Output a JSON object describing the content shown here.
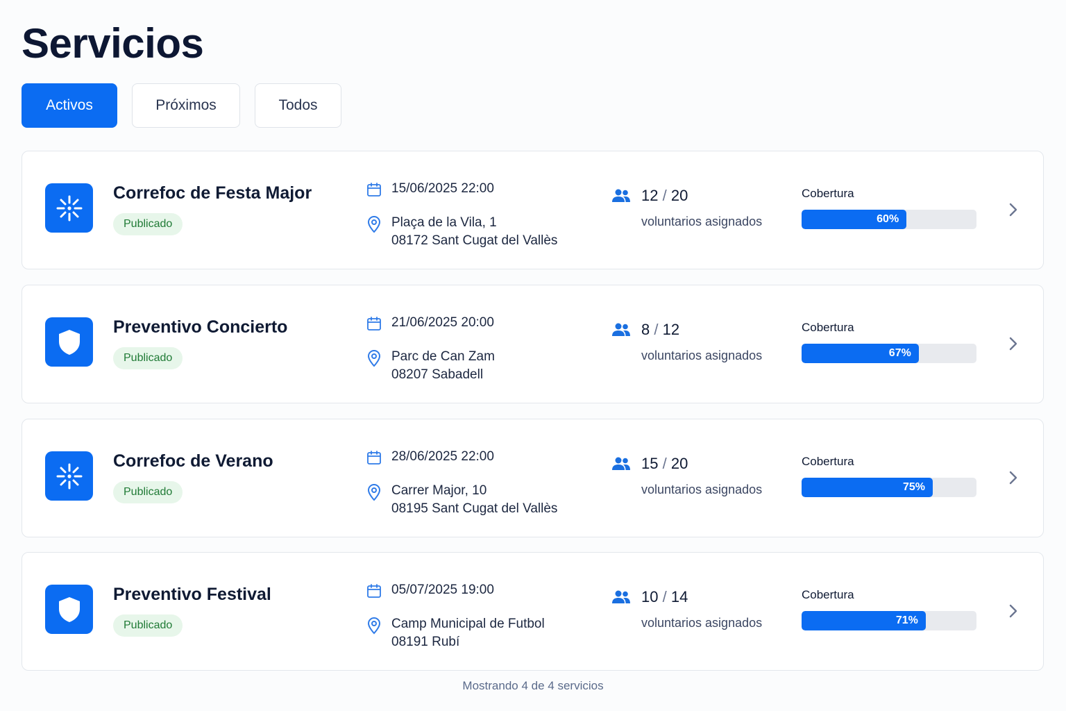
{
  "page": {
    "title": "Servicios"
  },
  "tabs": [
    {
      "label": "Activos",
      "active": true
    },
    {
      "label": "Próximos",
      "active": false
    },
    {
      "label": "Todos",
      "active": false
    }
  ],
  "colors": {
    "accent": "#0b6cf2",
    "badge_bg": "#e7f6ea",
    "badge_text": "#1f7a35",
    "bar_track": "#e8eaee"
  },
  "services": [
    {
      "icon": "sparkle-icon",
      "title": "Correfoc de Festa Major",
      "status": "Publicado",
      "datetime": "15/06/2025 22:00",
      "address_line1": "Plaça de la Vila, 1",
      "address_line2": "08172 Sant Cugat del Vallès",
      "assigned": "12",
      "slash": "/",
      "total": "20",
      "volunteers_label": "voluntarios asignados",
      "coverage_label": "Cobertura",
      "coverage": 60,
      "coverage_text": "60%"
    },
    {
      "icon": "shield-icon",
      "title": "Preventivo Concierto",
      "status": "Publicado",
      "datetime": "21/06/2025 20:00",
      "address_line1": "Parc de Can Zam",
      "address_line2": "08207 Sabadell",
      "assigned": "8",
      "slash": "/",
      "total": "12",
      "volunteers_label": "voluntarios asignados",
      "coverage_label": "Cobertura",
      "coverage": 67,
      "coverage_text": "67%"
    },
    {
      "icon": "sparkle-icon",
      "title": "Correfoc de Verano",
      "status": "Publicado",
      "datetime": "28/06/2025 22:00",
      "address_line1": "Carrer Major, 10",
      "address_line2": "08195 Sant Cugat del Vallès",
      "assigned": "15",
      "slash": "/",
      "total": "20",
      "volunteers_label": "voluntarios asignados",
      "coverage_label": "Cobertura",
      "coverage": 75,
      "coverage_text": "75%"
    },
    {
      "icon": "shield-icon",
      "title": "Preventivo Festival",
      "status": "Publicado",
      "datetime": "05/07/2025 19:00",
      "address_line1": "Camp Municipal de Futbol",
      "address_line2": "08191 Rubí",
      "assigned": "10",
      "slash": "/",
      "total": "14",
      "volunteers_label": "voluntarios asignados",
      "coverage_label": "Cobertura",
      "coverage": 71,
      "coverage_text": "71%"
    }
  ],
  "footer": {
    "text": "Mostrando 4 de 4 servicios"
  }
}
